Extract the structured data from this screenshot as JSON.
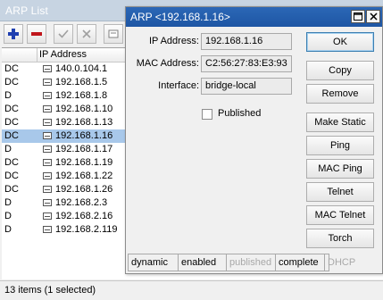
{
  "list_window": {
    "title": "ARP List",
    "toolbar": {
      "icons": [
        "add-icon",
        "remove-icon",
        "enable-check-icon",
        "disable-x-icon",
        "comment-icon"
      ],
      "colors": {
        "add": "#1f3fb0",
        "remove": "#c0161c"
      }
    },
    "columns": {
      "flags": "",
      "address": "IP Address"
    },
    "rows": [
      {
        "flags": "DC",
        "ip": "140.0.104.1",
        "selected": false
      },
      {
        "flags": "DC",
        "ip": "192.168.1.5",
        "selected": false
      },
      {
        "flags": "D",
        "ip": "192.168.1.8",
        "selected": false
      },
      {
        "flags": "DC",
        "ip": "192.168.1.10",
        "selected": false
      },
      {
        "flags": "DC",
        "ip": "192.168.1.13",
        "selected": false
      },
      {
        "flags": "DC",
        "ip": "192.168.1.16",
        "selected": true
      },
      {
        "flags": "D",
        "ip": "192.168.1.17",
        "selected": false
      },
      {
        "flags": "DC",
        "ip": "192.168.1.19",
        "selected": false
      },
      {
        "flags": "DC",
        "ip": "192.168.1.22",
        "selected": false
      },
      {
        "flags": "DC",
        "ip": "192.168.1.26",
        "selected": false
      },
      {
        "flags": "D",
        "ip": "192.168.2.3",
        "selected": false
      },
      {
        "flags": "D",
        "ip": "192.168.2.16",
        "selected": false
      },
      {
        "flags": "D",
        "ip": "192.168.2.119",
        "selected": false
      }
    ],
    "status": "13 items (1 selected)"
  },
  "dialog": {
    "title": "ARP <192.168.1.16>",
    "fields": {
      "ip_label": "IP Address:",
      "ip_value": "192.168.1.16",
      "mac_label": "MAC Address:",
      "mac_value": "C2:56:27:83:E3:93",
      "interface_label": "Interface:",
      "interface_value": "bridge-local"
    },
    "published_label": "Published",
    "published_checked": false,
    "buttons": {
      "ok": "OK",
      "copy": "Copy",
      "remove": "Remove",
      "make_static": "Make Static",
      "ping": "Ping",
      "mac_ping": "MAC Ping",
      "telnet": "Telnet",
      "mac_telnet": "MAC Telnet",
      "torch": "Torch"
    },
    "status": {
      "dynamic": "dynamic",
      "enabled": "enabled",
      "published": "published",
      "complete": "complete",
      "dhcp": "DHCP"
    },
    "window_buttons": [
      "restore-icon",
      "close-icon"
    ],
    "title_color": "#1e56a4",
    "selection_color": "#a8c8ea"
  }
}
